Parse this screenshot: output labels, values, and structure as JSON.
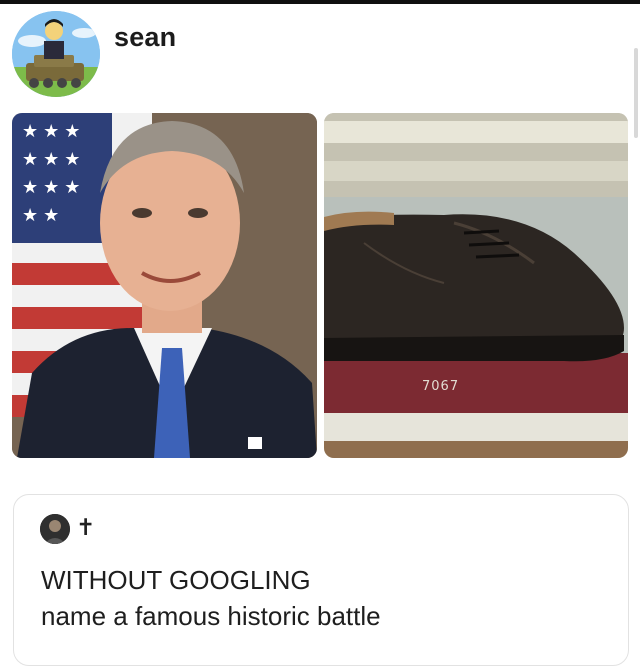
{
  "post": {
    "username": "sean",
    "avatar_icon": "cartoon-avatar-icon"
  },
  "images": {
    "left": {
      "description_icon": "portrait-photo-icon"
    },
    "right": {
      "description_icon": "shoe-photo-icon",
      "tag_label": "7067"
    }
  },
  "quote": {
    "handle": "✝",
    "line1": "WITHOUT GOOGLING",
    "line2": "name a famous historic battle"
  },
  "colors": {
    "text": "#1c1c1c",
    "card_border": "#e2e2e2",
    "background": "#ffffff"
  }
}
